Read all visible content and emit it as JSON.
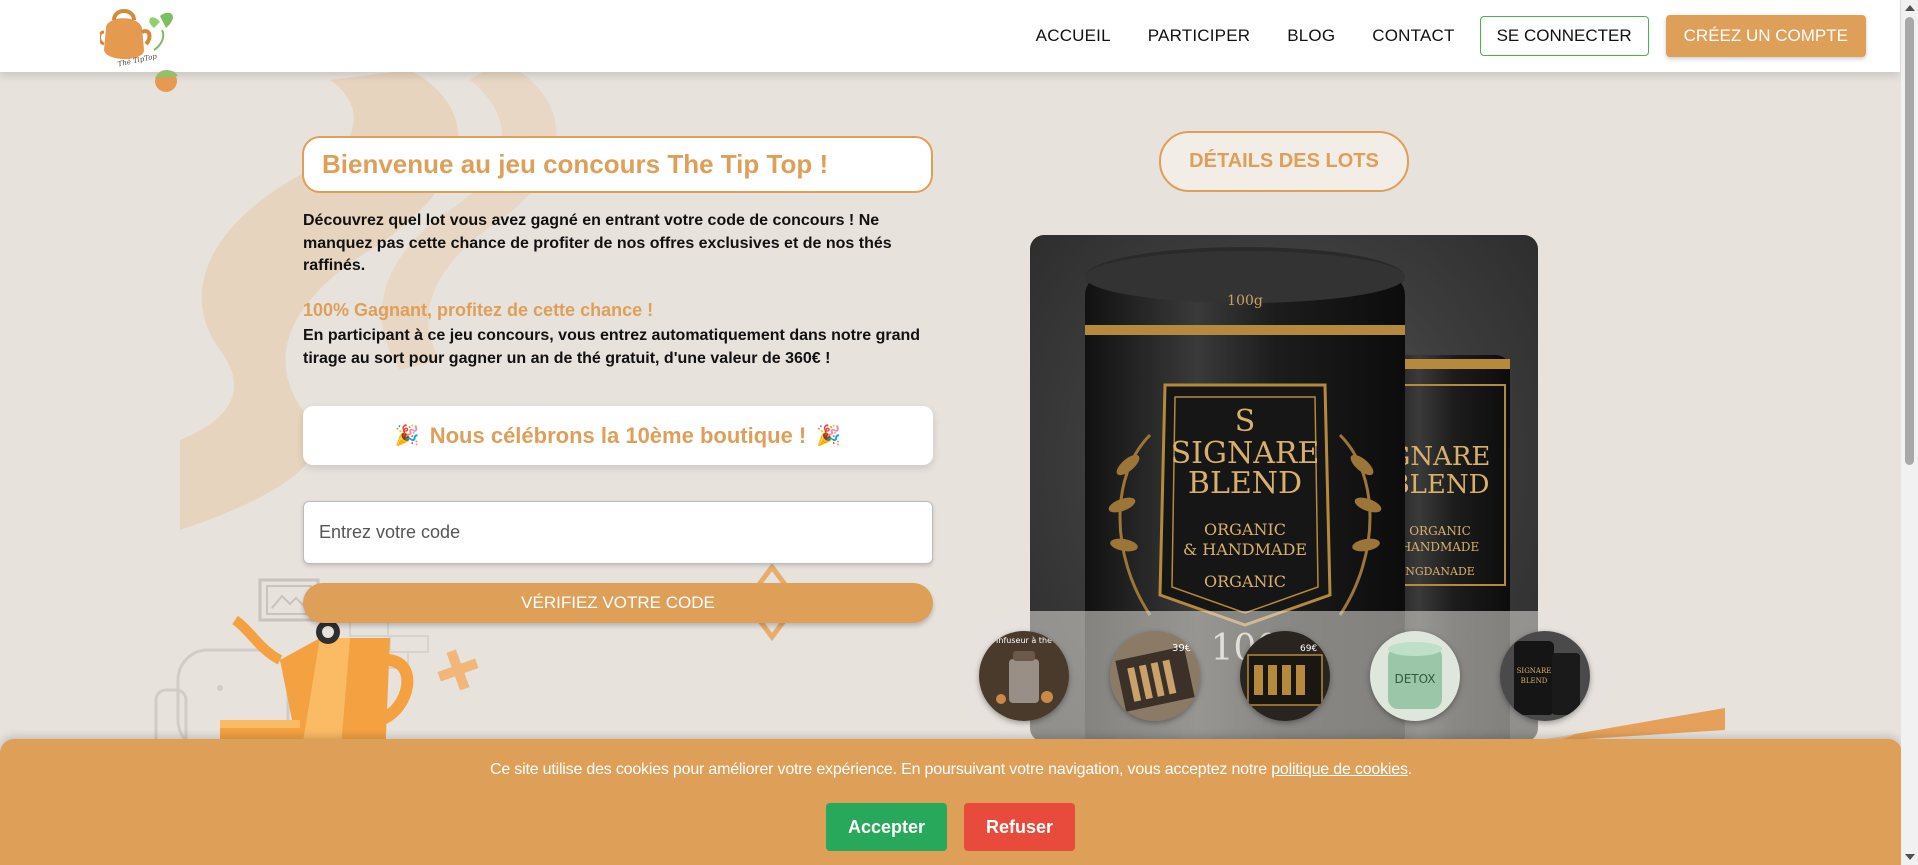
{
  "header": {
    "logo_text": "Thé TipTop",
    "nav": [
      "ACCUEIL",
      "PARTICIPER",
      "BLOG",
      "CONTACT"
    ],
    "login_label": "SE CONNECTER",
    "signup_label": "CRÉEZ UN COMPTE"
  },
  "main": {
    "title": "Bienvenue au jeu concours The Tip Top !",
    "intro": "Découvrez quel lot vous avez gagné en entrant votre code de concours ! Ne manquez pas cette chance de profiter de nos offres exclusives et de nos thés raffinés.",
    "promo_title": "100% Gagnant, profitez de cette chance !",
    "promo_text": "En participant à ce jeu concours, vous entrez automatiquement dans notre grand tirage au sort pour gagner un an de thé gratuit, d'une valeur de 360€ !",
    "celebrate_text": "Nous célébrons la 10ème boutique !",
    "celebrate_emoji": "🎉",
    "code_placeholder": "Entrez votre code",
    "verify_label": "VÉRIFIEZ VOTRE CODE"
  },
  "lots": {
    "button_label": "DÉTAILS DES LOTS",
    "product": {
      "brand_line1": "SIGNARE",
      "brand_line2": "BLEND",
      "sub1": "ORGANIC",
      "sub2": "& HANDMADE",
      "sub3": "ORGANIC",
      "weight": "100g",
      "back_line1": "GNARE",
      "back_line2": "BLEND",
      "back_sub1": "ORGANIC",
      "back_sub2": "HANDMADE",
      "back_sub3": "NGDANADE",
      "overlay_number": "100"
    },
    "thumbnails": [
      "infuseur-a-the",
      "coffret-39",
      "coffret-69",
      "the-detox",
      "the-signature"
    ],
    "thumb_texts": {
      "infuseur": "Infuseur à thé",
      "coffret39": "39€",
      "coffret69": "69€",
      "detox": "DETOX",
      "signature_line1": "SIGNARE",
      "signature_line2": "BLEND"
    }
  },
  "cookie": {
    "text": "Ce site utilise des cookies pour améliorer votre expérience. En poursuivant votre navigation, vous acceptez notre",
    "link": "politique de cookies",
    "suffix": ".",
    "accept_label": "Accepter",
    "refuse_label": "Refuser"
  },
  "colors": {
    "accent": "#de9f59",
    "background": "#e8e2dd",
    "accept": "#28a85a",
    "refuse": "#e84b3c"
  }
}
